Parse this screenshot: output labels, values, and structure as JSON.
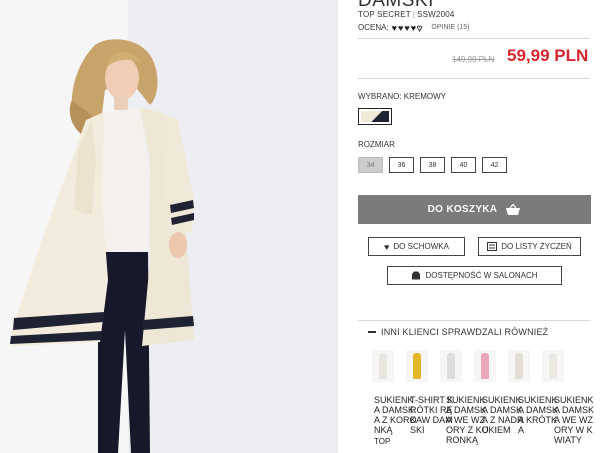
{
  "product": {
    "title": "DAMSKI",
    "brand": "TOP SECRET",
    "sku": "SSW2004",
    "rating_label": "OCENA:",
    "rating_value": 4,
    "rating_max": 5,
    "reviews_label": "OPINIE (15)",
    "old_price": "149,99 PLN",
    "new_price": "59,99 PLN"
  },
  "variant": {
    "selected_label": "WYBRANO: KREMOWY",
    "swatch_colors": [
      "#f1ead8",
      "#1f2233"
    ]
  },
  "sizes": {
    "label": "ROZMIAR",
    "options": [
      "34",
      "36",
      "38",
      "40",
      "42"
    ],
    "selected": "34"
  },
  "actions": {
    "add_to_cart": "DO KOSZYKA",
    "to_storage": "DO SCHOWKA",
    "to_wishlist": "DO LISTY ŻYCZEŃ",
    "availability": "DOSTĘPNOŚĆ W SALONACH"
  },
  "also_viewed": {
    "title": "INNI KLIENCI SPRAWDZALI RÓWNIEŻ",
    "items": [
      {
        "name": "SUKIENKA DAMSKA Z KORONKĄ",
        "brand": "TOP",
        "color": "#e9e6e1"
      },
      {
        "name": "T-SHIRT KRÓTKI RĘKAW DAMSKI",
        "brand": "",
        "color": "#e3b72a"
      },
      {
        "name": "SUKIENKA DAMSKA WE WZORY Z KORONKĄ",
        "brand": "",
        "color": "#dcdcdc"
      },
      {
        "name": "SUKIENKA DAMSKA Z NADRUKIEM",
        "brand": "",
        "color": "#e7a7b9"
      },
      {
        "name": "SUKIENKA DAMSKA KRÓTKA",
        "brand": "",
        "color": "#e3dfd6"
      },
      {
        "name": "SUKIENKA DAMSKA WE WZORY W KWIATY",
        "brand": "",
        "color": "#ece9e4"
      }
    ]
  },
  "colors": {
    "price_accent": "#d7262d",
    "cart_button": "#7b7b7b"
  }
}
